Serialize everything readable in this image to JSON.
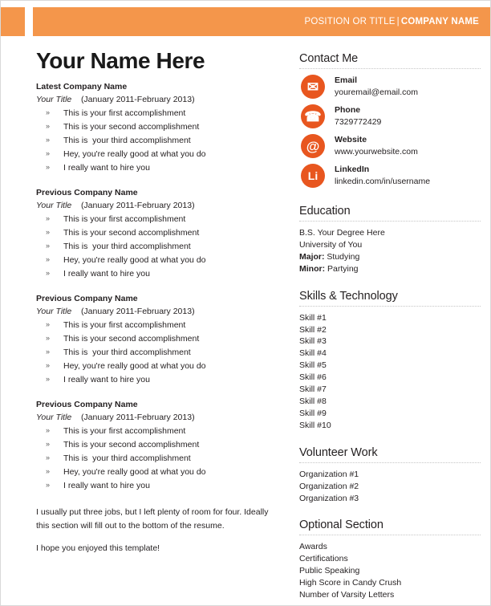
{
  "header": {
    "position_label": "POSITION OR TITLE",
    "separator": "|",
    "company_label": "COMPANY NAME"
  },
  "colors": {
    "header_orange": "#f4964b",
    "icon_orange": "#e8561f",
    "text": "#231f20",
    "rule": "#c6c6c6"
  },
  "left": {
    "name": "Your Name Here",
    "jobs": [
      {
        "company": "Latest Company Name",
        "title": "Your Title",
        "dates": "(January 2011-February 2013)",
        "bullets": [
          "This is your first accomplishment",
          "This is your second accomplishment",
          "This is  your third accomplishment",
          "Hey, you're really good at what you do",
          "I really want to hire you"
        ]
      },
      {
        "company": "Previous Company Name",
        "title": "Your Title",
        "dates": "(January 2011-February 2013)",
        "bullets": [
          "This is your first accomplishment",
          "This is your second accomplishment",
          "This is  your third accomplishment",
          "Hey, you're really good at what you do",
          "I really want to hire you"
        ]
      },
      {
        "company": "Previous Company Name",
        "title": "Your Title",
        "dates": "(January 2011-February 2013)",
        "bullets": [
          "This is your first accomplishment",
          "This is your second accomplishment",
          "This is  your third accomplishment",
          "Hey, you're really good at what you do",
          "I really want to hire you"
        ]
      },
      {
        "company": "Previous Company Name",
        "title": "Your Title",
        "dates": "(January 2011-February 2013)",
        "bullets": [
          "This is your first accomplishment",
          "This is your second accomplishment",
          "This is  your third accomplishment",
          "Hey, you're really good at what you do",
          "I really want to hire you"
        ]
      }
    ],
    "bullet_mark": "»",
    "closing_paragraph": "I usually put three jobs, but I left plenty of room for four. Ideally this section will fill out to the bottom of the resume.",
    "closing_note": "I hope you enjoyed this template!"
  },
  "right": {
    "contact": {
      "title": "Contact Me",
      "items": [
        {
          "icon": "envelope-icon",
          "glyph": "✉",
          "label": "Email",
          "value": "youremail@email.com"
        },
        {
          "icon": "telephone-icon",
          "glyph": "☎",
          "label": "Phone",
          "value": "7329772429"
        },
        {
          "icon": "at-sign-icon",
          "glyph": "@",
          "label": "Website",
          "value": "www.yourwebsite.com"
        },
        {
          "icon": "linkedin-icon",
          "glyph": "Li",
          "label": "LinkedIn",
          "value": "linkedin.com/in/username"
        }
      ]
    },
    "education": {
      "title": "Education",
      "degree": "B.S. Your Degree Here",
      "school": "University of You",
      "major_label": "Major:",
      "major_value": " Studying",
      "minor_label": "Minor:",
      "minor_value": " Partying"
    },
    "skills": {
      "title": "Skills & Technology",
      "items": [
        "Skill #1",
        "Skill #2",
        "Skill #3",
        "Skill #4",
        "Skill #5",
        "Skill #6",
        "Skill #7",
        "Skill #8",
        "Skill #9",
        "Skill #10"
      ]
    },
    "volunteer": {
      "title": "Volunteer Work",
      "items": [
        "Organization #1",
        "Organization #2",
        "Organization #3"
      ]
    },
    "optional": {
      "title": "Optional Section",
      "items": [
        "Awards",
        "Certifications",
        "Public Speaking",
        "High Score in Candy Crush",
        "Number of Varsity Letters"
      ]
    }
  }
}
